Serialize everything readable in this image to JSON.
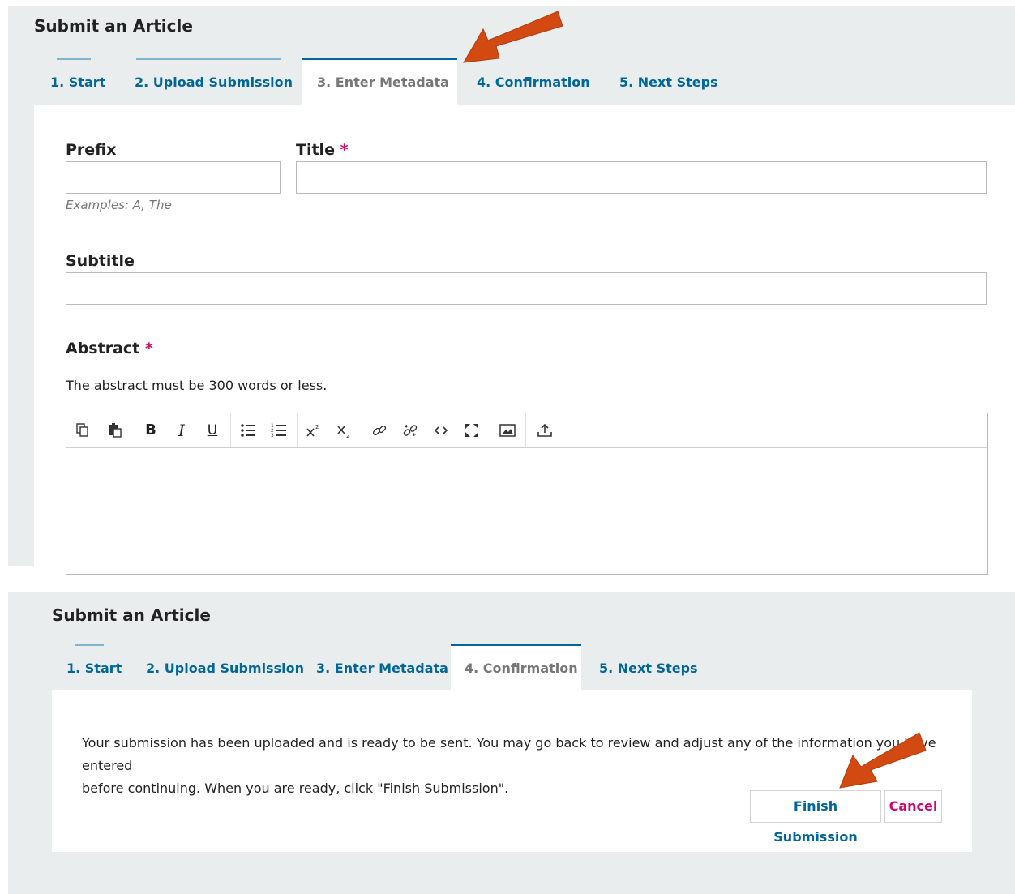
{
  "top": {
    "heading": "Submit an Article",
    "tabs": [
      {
        "label": "1. Start"
      },
      {
        "label": "2. Upload Submission"
      },
      {
        "label": "3. Enter Metadata"
      },
      {
        "label": "4. Confirmation"
      },
      {
        "label": "5. Next Steps"
      }
    ],
    "active_tab": 2,
    "form": {
      "prefix_label": "Prefix",
      "prefix_hint": "Examples: A, The",
      "title_label": "Title",
      "required_mark": "*",
      "subtitle_label": "Subtitle",
      "abstract_label": "Abstract",
      "abstract_description": "The abstract must be 300 words or less.",
      "toolbar_icons": [
        "copy-icon",
        "paste-icon",
        "bold-icon",
        "italic-icon",
        "underline-icon",
        "bullet-list-icon",
        "numbered-list-icon",
        "superscript-icon",
        "subscript-icon",
        "link-icon",
        "unlink-icon",
        "code-icon",
        "fullscreen-icon",
        "image-icon",
        "upload-icon"
      ]
    }
  },
  "bottom": {
    "heading": "Submit an Article",
    "tabs": [
      {
        "label": "1. Start"
      },
      {
        "label": "2. Upload Submission"
      },
      {
        "label": "3. Enter Metadata"
      },
      {
        "label": "4. Confirmation"
      },
      {
        "label": "5. Next Steps"
      }
    ],
    "active_tab": 3,
    "message_line1": "Your submission has been uploaded and is ready to be sent. You may go back to review and adjust any of the information you have entered",
    "message_line2": "before continuing. When you are ready, click \"Finish Submission\".",
    "finish_button": "Finish Submission",
    "cancel_button": "Cancel"
  },
  "colors": {
    "link_blue": "#006798",
    "required_pink": "#d00a6c",
    "panel_gray": "#e9edee",
    "arrow_orange": "#d24a12"
  }
}
